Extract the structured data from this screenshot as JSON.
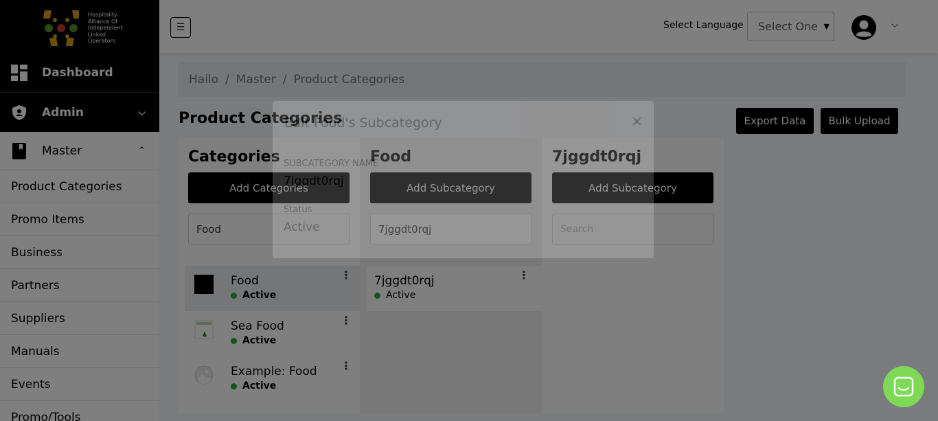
{
  "brand": {
    "logo_lines": [
      "Hospitality",
      "Alliance Of",
      "Independent",
      "Linked",
      "Operators"
    ],
    "logo_colors": {
      "yellow": "#d4a017",
      "green": "#5a8f29",
      "red": "#c0392b"
    }
  },
  "sidebar": {
    "items": [
      {
        "label": "Dashboard",
        "icon": "dashboard-icon"
      },
      {
        "label": "Admin",
        "icon": "shield-icon"
      },
      {
        "label": "Master",
        "icon": "book-icon"
      }
    ],
    "sub_items": [
      "Product Categories",
      "Promo Items",
      "Business",
      "Partners",
      "Suppliers",
      "Manuals",
      "Events",
      "Promo/Tools"
    ]
  },
  "topbar": {
    "language_label": "Select Language",
    "language_select_value": "Select One"
  },
  "breadcrumb": [
    "Hailo",
    "Master",
    "Product Categories"
  ],
  "page": {
    "title": "Product Categories",
    "export_label": "Export Data",
    "bulk_label": "Bulk Upload"
  },
  "panels": {
    "categories": {
      "title": "Categories",
      "button": "Add Categories",
      "search_value": "Food",
      "rows": [
        {
          "name": "Food",
          "status": "Active"
        },
        {
          "name": "Sea Food",
          "status": "Active"
        },
        {
          "name": "Example: Food",
          "status": "Active"
        }
      ]
    },
    "subcategory": {
      "title": "Food",
      "button": "Add Subcategory",
      "search_value": "7jggdt0rqj",
      "row": {
        "name": "7jggdt0rqj",
        "status": "Active"
      }
    },
    "third": {
      "title": "7jggdt0rqj",
      "button": "Add Subcategory",
      "search_placeholder": "Search"
    }
  },
  "modal": {
    "title": "Edit Food's Subcategory",
    "close": "×",
    "name_label": "SUBCATEGORY NAME",
    "name_value": "7jggdt0rqj",
    "status_label": "Status",
    "status_value": "Active"
  },
  "colors": {
    "accent": "#000000",
    "active_dot": "#28a745",
    "chat": "#7ed957"
  }
}
